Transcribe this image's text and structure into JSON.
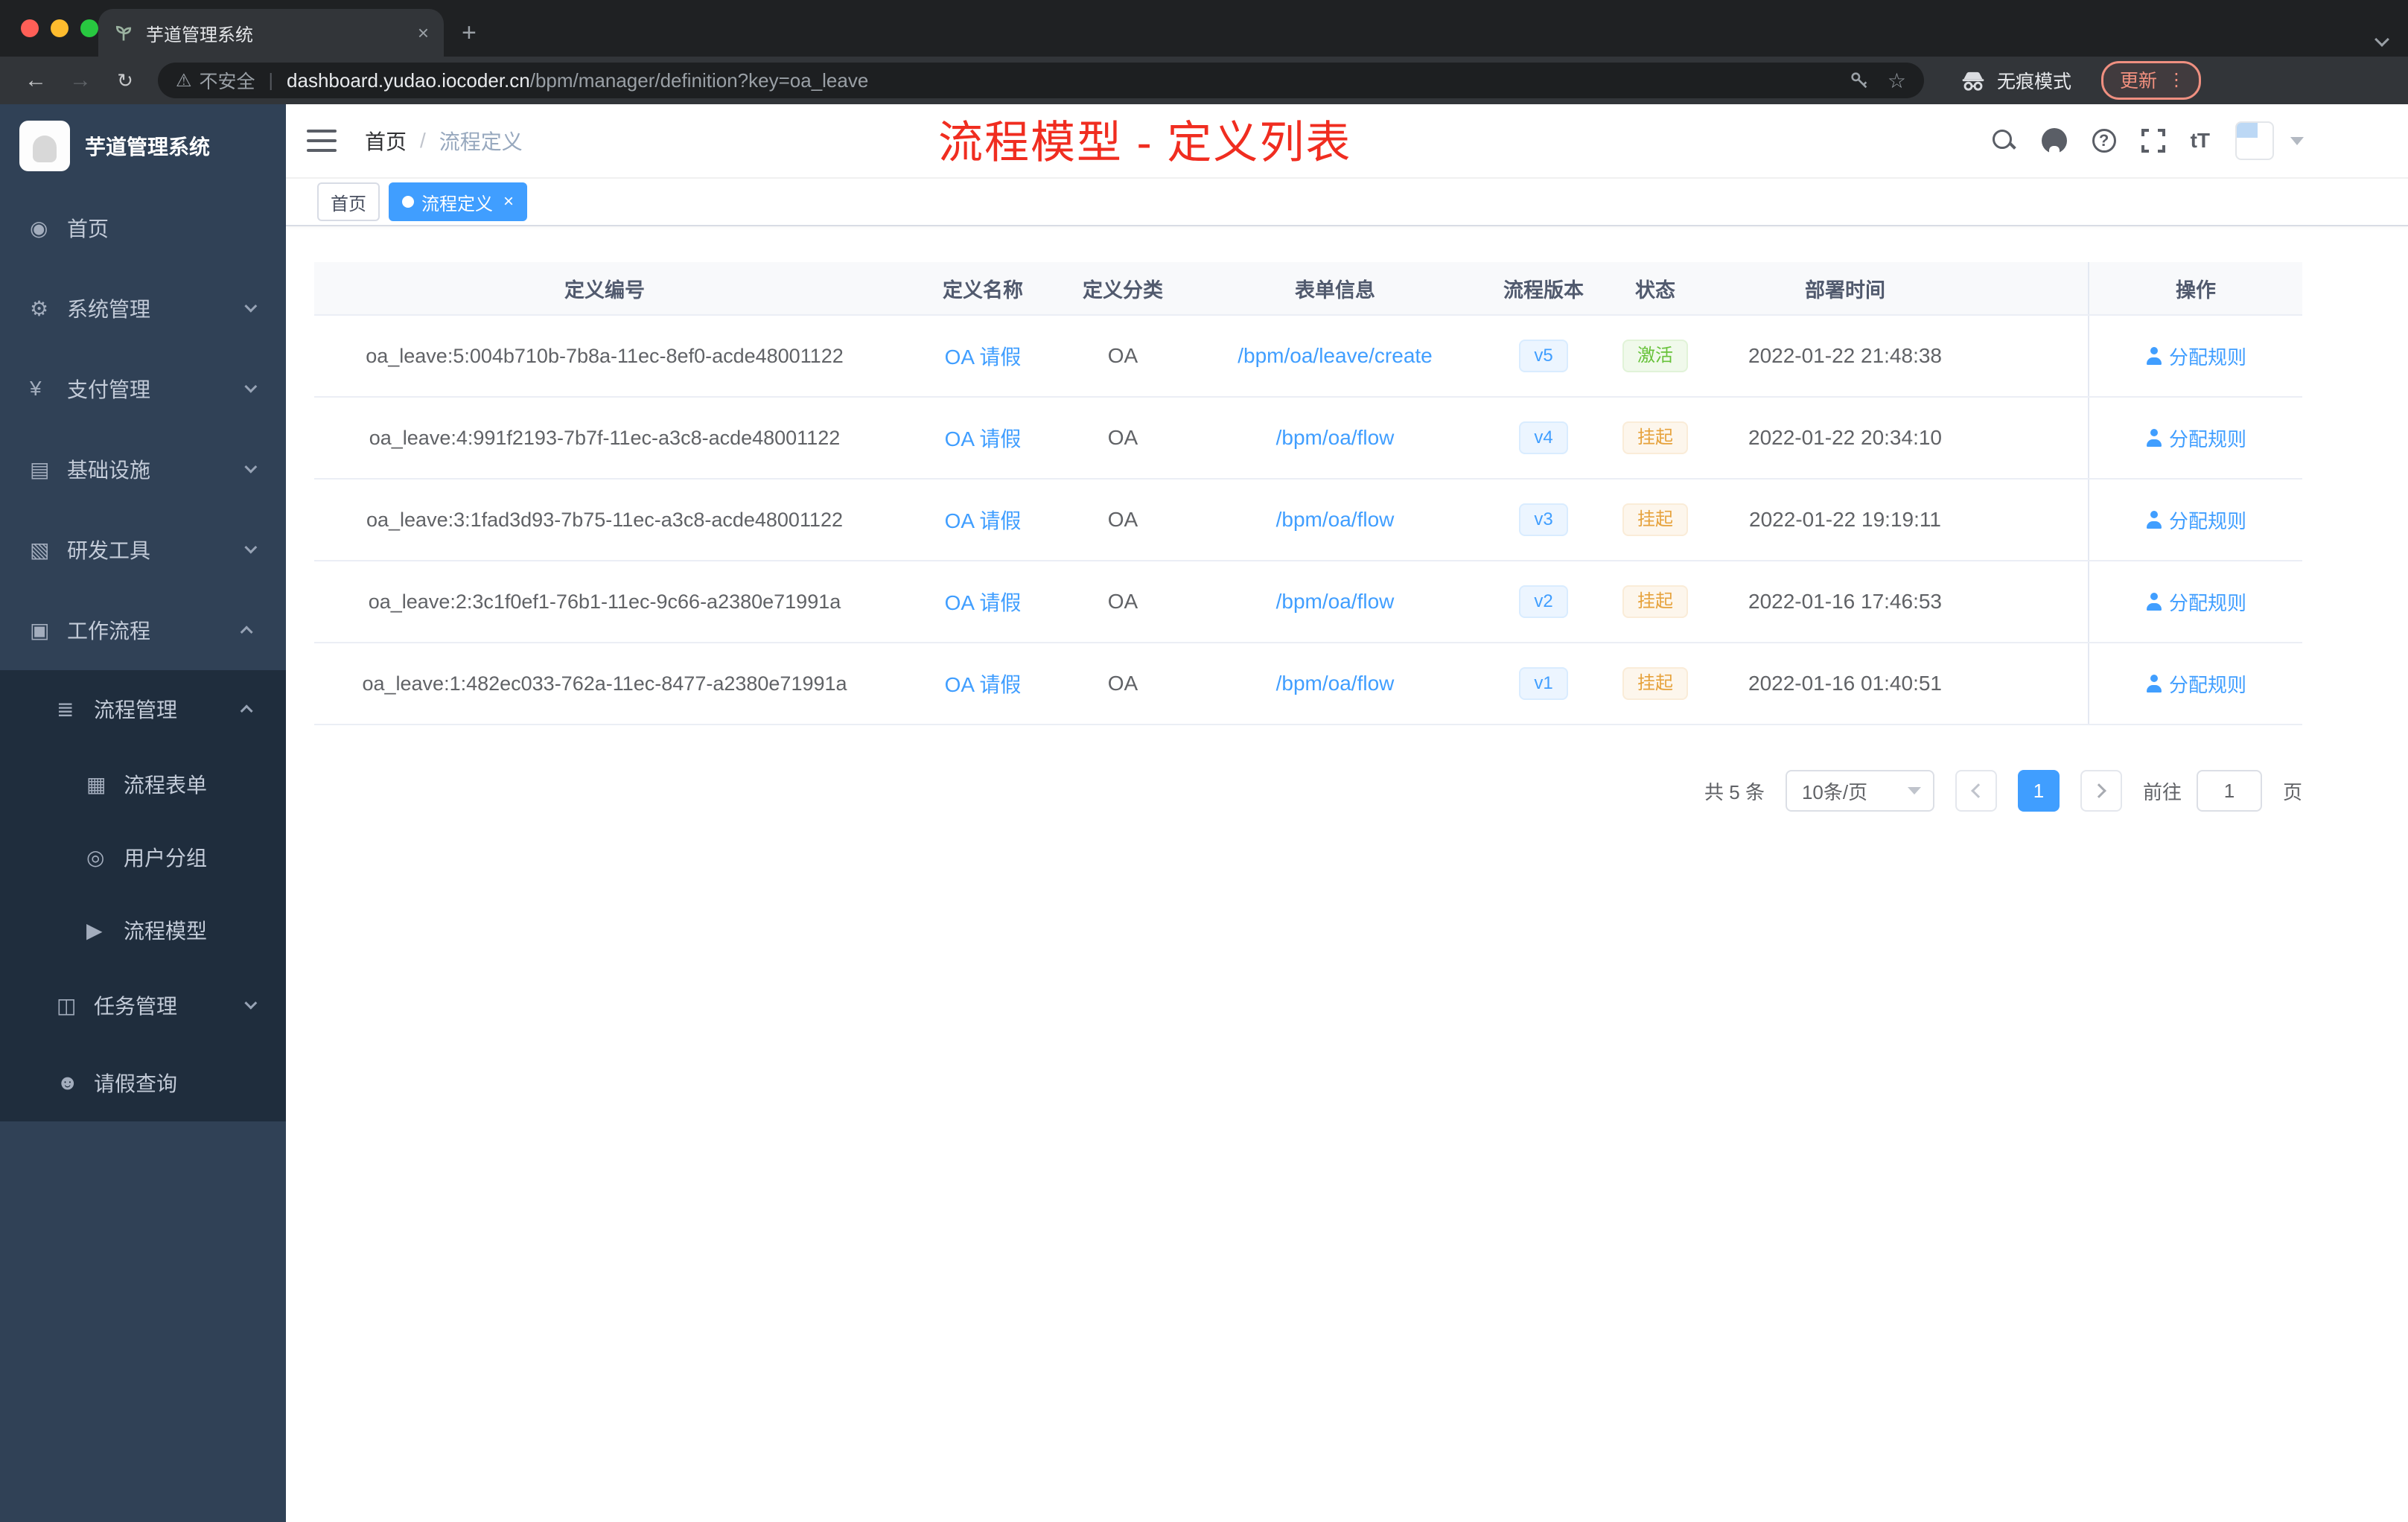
{
  "colors": {
    "accent": "#409eff",
    "success": "#67c23a",
    "warning": "#e6a23c",
    "annotation": "#f02d20",
    "sidebar_bg": "#304156",
    "sidebar_sub_bg": "#1f2d3d"
  },
  "browser": {
    "tab_title": "芋道管理系统",
    "security_label": "不安全",
    "url_host": "dashboard.yudao.iocoder.cn",
    "url_path": "/bpm/manager/definition?key=oa_leave",
    "incognito_label": "无痕模式",
    "update_label": "更新"
  },
  "sidebar": {
    "logo_title": "芋道管理系统",
    "menu": [
      {
        "label": "首页",
        "icon": "◉",
        "icon_name": "home-icon",
        "level": 1
      },
      {
        "label": "系统管理",
        "icon": "⚙",
        "icon_name": "gear-icon",
        "level": 1,
        "chevron": "down"
      },
      {
        "label": "支付管理",
        "icon": "¥",
        "icon_name": "payment-icon",
        "level": 1,
        "chevron": "down"
      },
      {
        "label": "基础设施",
        "icon": "▤",
        "icon_name": "infrastructure-icon",
        "level": 1,
        "chevron": "down"
      },
      {
        "label": "研发工具",
        "icon": "▧",
        "icon_name": "dev-tools-icon",
        "level": 1,
        "chevron": "down"
      },
      {
        "label": "工作流程",
        "icon": "▣",
        "icon_name": "workflow-icon",
        "level": 1,
        "chevron": "up"
      },
      {
        "label": "流程管理",
        "icon": "≣",
        "icon_name": "process-management-icon",
        "level": 2,
        "chevron": "up"
      },
      {
        "label": "流程表单",
        "icon": "▦",
        "icon_name": "process-form-icon",
        "level": 3
      },
      {
        "label": "用户分组",
        "icon": "◎",
        "icon_name": "user-group-icon",
        "level": 3
      },
      {
        "label": "流程模型",
        "icon": "▶",
        "icon_name": "process-model-icon",
        "level": 3
      },
      {
        "label": "任务管理",
        "icon": "◫",
        "icon_name": "task-management-icon",
        "level": 2,
        "chevron": "down"
      },
      {
        "label": "请假查询",
        "icon": "☻",
        "icon_name": "leave-query-icon",
        "level": 2
      }
    ]
  },
  "header": {
    "breadcrumb": [
      "首页",
      "流程定义"
    ],
    "annotation": "流程模型 - 定义列表"
  },
  "tags": [
    {
      "label": "首页"
    },
    {
      "label": "流程定义",
      "state": "active",
      "close": "×"
    }
  ],
  "table": {
    "columns": [
      "定义编号",
      "定义名称",
      "定义分类",
      "表单信息",
      "流程版本",
      "状态",
      "部署时间",
      "操作"
    ],
    "rows": [
      {
        "id": "oa_leave:5:004b710b-7b8a-11ec-8ef0-acde48001122",
        "name": "OA 请假",
        "category": "OA",
        "form": "/bpm/oa/leave/create",
        "version": "v5",
        "status": "激活",
        "status_type": "success",
        "deploy_time": "2022-01-22 21:48:38",
        "action": "分配规则"
      },
      {
        "id": "oa_leave:4:991f2193-7b7f-11ec-a3c8-acde48001122",
        "name": "OA 请假",
        "category": "OA",
        "form": "/bpm/oa/flow",
        "version": "v4",
        "status": "挂起",
        "status_type": "warning",
        "deploy_time": "2022-01-22 20:34:10",
        "action": "分配规则"
      },
      {
        "id": "oa_leave:3:1fad3d93-7b75-11ec-a3c8-acde48001122",
        "name": "OA 请假",
        "category": "OA",
        "form": "/bpm/oa/flow",
        "version": "v3",
        "status": "挂起",
        "status_type": "warning",
        "deploy_time": "2022-01-22 19:19:11",
        "action": "分配规则"
      },
      {
        "id": "oa_leave:2:3c1f0ef1-76b1-11ec-9c66-a2380e71991a",
        "name": "OA 请假",
        "category": "OA",
        "form": "/bpm/oa/flow",
        "version": "v2",
        "status": "挂起",
        "status_type": "warning",
        "deploy_time": "2022-01-16 17:46:53",
        "action": "分配规则"
      },
      {
        "id": "oa_leave:1:482ec033-762a-11ec-8477-a2380e71991a",
        "name": "OA 请假",
        "category": "OA",
        "form": "/bpm/oa/flow",
        "version": "v1",
        "status": "挂起",
        "status_type": "warning",
        "deploy_time": "2022-01-16 01:40:51",
        "action": "分配规则"
      }
    ]
  },
  "pagination": {
    "total_label": "共 5 条",
    "page_size_label": "10条/页",
    "current_page": "1",
    "goto_label": "前往",
    "goto_value": "1",
    "page_unit_label": "页"
  }
}
